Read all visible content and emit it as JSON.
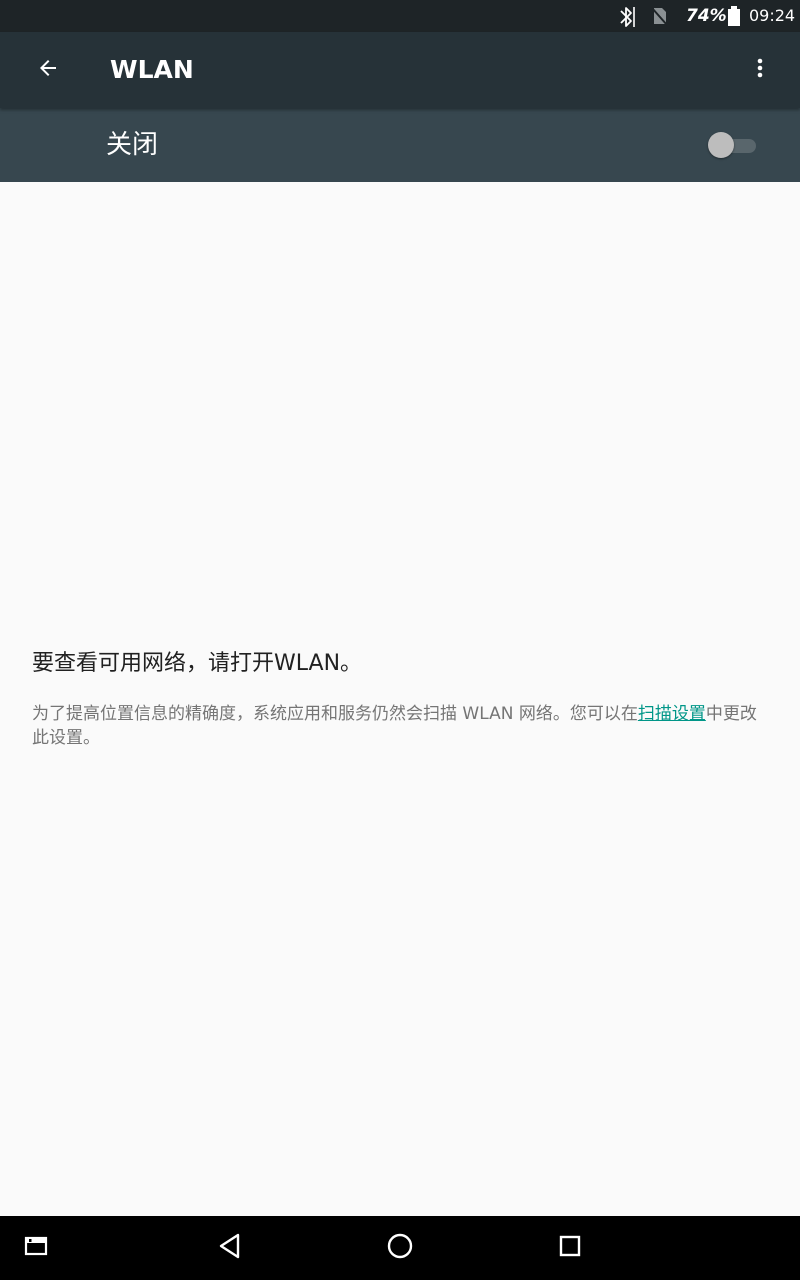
{
  "status_bar": {
    "battery_percent": "74%",
    "time": "09:24",
    "icons": [
      "bluetooth-icon",
      "no-sim-icon",
      "battery-icon"
    ]
  },
  "app_bar": {
    "title": "WLAN",
    "back_icon": "arrow-back-icon",
    "menu_icon": "more-vert-icon"
  },
  "switch_bar": {
    "label": "关闭",
    "checked": false
  },
  "empty_state": {
    "heading": "要查看可用网络，请打开WLAN。",
    "description_before": "为了提高位置信息的精确度，系统应用和服务仍然会扫描 WLAN 网络。您可以在",
    "link_text": "扫描设置",
    "description_after": "中更改此设置。"
  },
  "nav_bar": {
    "icons": [
      "recent-apps-window-icon",
      "back-triangle-icon",
      "home-circle-icon",
      "overview-square-icon"
    ]
  },
  "colors": {
    "status_bar": "#1e2427",
    "app_bar": "#263238",
    "switch_bar": "#37474f",
    "background": "#fafafa",
    "link": "#009688"
  }
}
